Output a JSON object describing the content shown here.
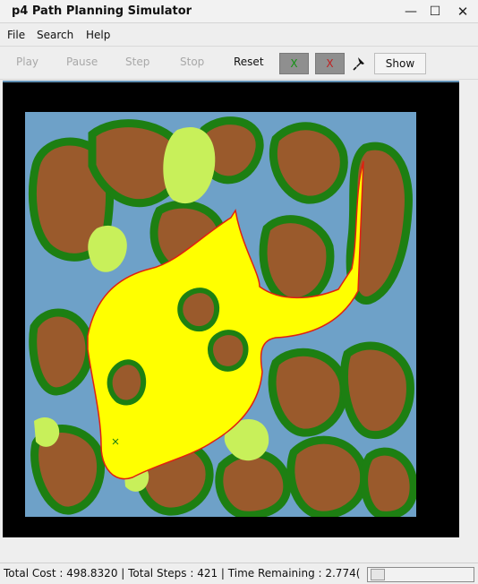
{
  "window": {
    "title": "p4 Path Planning Simulator",
    "controls": {
      "minimize": "—",
      "maximize": "☐",
      "close": "✕"
    }
  },
  "menu": [
    "File",
    "Search",
    "Help"
  ],
  "toolbar": {
    "play": "Play",
    "pause": "Pause",
    "step": "Step",
    "stop": "Stop",
    "reset": "Reset",
    "x_green": "X",
    "x_red": "X",
    "pin_icon": "pushpin-icon",
    "show": "Show"
  },
  "colors": {
    "water": "#6ea1c8",
    "land": "#9a5a2c",
    "forest": "#1d7f12",
    "grass": "#c8f05a",
    "path": "#ffff00",
    "path_border": "#e02010",
    "background": "#000000"
  },
  "status": {
    "text": "Total Cost : 498.8320 | Total Steps : 421 | Time Remaining : 2.774(",
    "slider_value": 0.03
  }
}
